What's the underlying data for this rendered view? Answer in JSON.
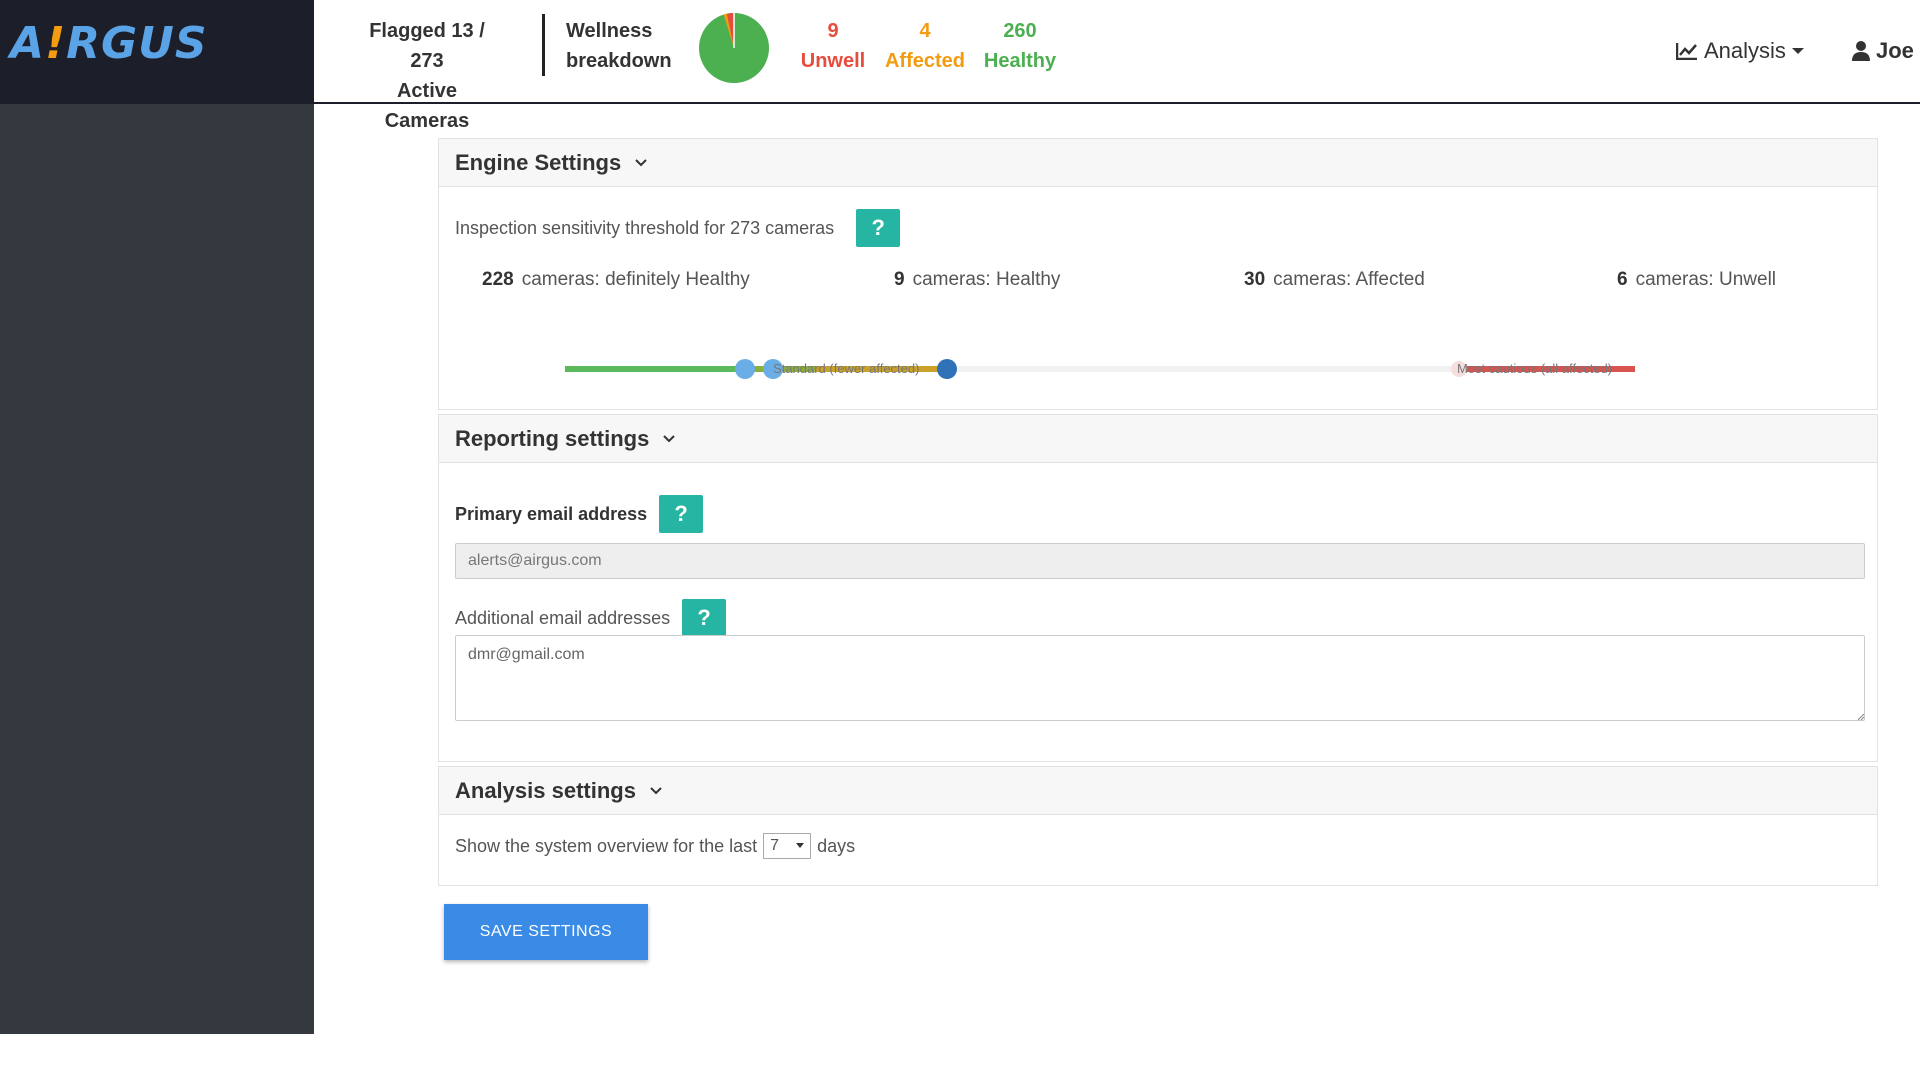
{
  "brand": {
    "logo_text_a": "A",
    "logo_text_dot": "!",
    "logo_text_rest": "RGUS",
    "color": "#5aa3e6"
  },
  "header": {
    "flag_line1": "Flagged 13 / 273",
    "flag_line2": "Active Cameras",
    "wellness_line1": "Wellness",
    "wellness_line2": "breakdown",
    "pie_chart": {
      "unwell": 9,
      "affected": 4,
      "healthy": 260
    },
    "stats": {
      "unwell_count": "9",
      "unwell_label": "Unwell",
      "unwell_color": "#e74c3c",
      "affected_count": "4",
      "affected_label": "Affected",
      "affected_color": "#f39c12",
      "healthy_count": "260",
      "healthy_label": "Healthy",
      "healthy_color": "#4caf50"
    },
    "nav_analysis_label": "Analysis",
    "nav_analysis_icon": "line-chart-icon",
    "nav_user_label": "Joe",
    "nav_user_icon": "user-icon"
  },
  "engine": {
    "title": "Engine Settings",
    "sensitivity_text": "Inspection sensitivity threshold for 273 cameras",
    "help_label": "?",
    "counts": [
      {
        "number": "228",
        "label": "cameras: definitely Healthy"
      },
      {
        "number": "9",
        "label": "cameras: Healthy"
      },
      {
        "number": "30",
        "label": "cameras: Affected"
      },
      {
        "number": "6",
        "label": "cameras: Unwell"
      }
    ],
    "slider_label_standard": "Standard (fewer affected)",
    "slider_label_cautious": "Most cautious (all affected)"
  },
  "reporting": {
    "title": "Reporting settings",
    "primary_label": "Primary email address",
    "primary_value": "alerts@airgus.com",
    "additional_label": "Additional email addresses",
    "additional_value": "dmr@gmail.com",
    "help_label": "?"
  },
  "analysis": {
    "title": "Analysis settings",
    "overview_prefix": "Show the system overview for the last",
    "days_value": "7",
    "overview_suffix": "days"
  },
  "save_label": "SAVE SETTINGS"
}
